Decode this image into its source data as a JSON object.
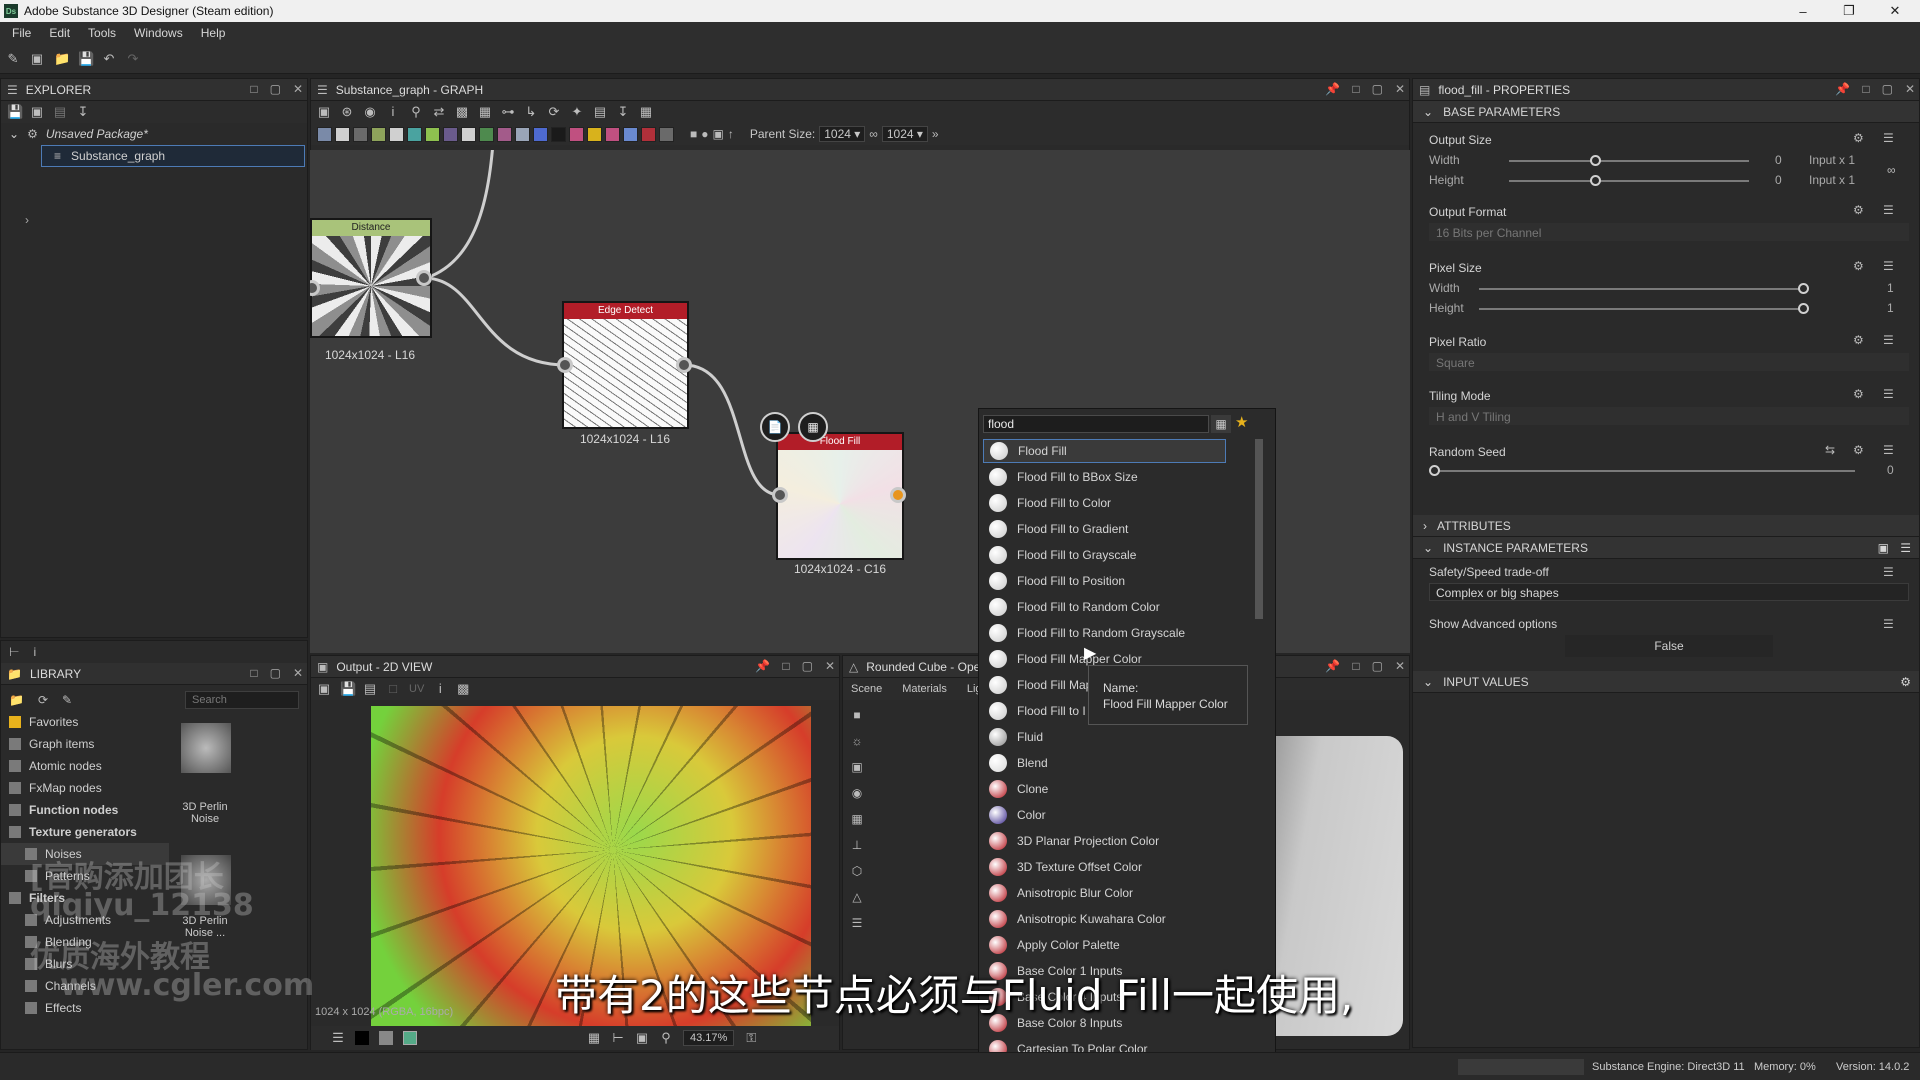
{
  "window": {
    "title": "Adobe Substance 3D Designer (Steam edition)",
    "logo": "Ds"
  },
  "menu": [
    "File",
    "Edit",
    "Tools",
    "Windows",
    "Help"
  ],
  "explorer": {
    "title": "EXPLORER",
    "package": "Unsaved Package*",
    "graph": "Substance_graph"
  },
  "graph": {
    "title": "Substance_graph - GRAPH",
    "parent_size_label": "Parent Size:",
    "parent_size_w": "1024",
    "parent_size_h": "1024",
    "nodes": {
      "distance": {
        "title": "Distance",
        "caption": "1024x1024 - L16"
      },
      "edge": {
        "title": "Edge Detect",
        "caption": "1024x1024 - L16"
      },
      "flood": {
        "title": "Flood Fill",
        "caption": "1024x1024 - C16"
      }
    }
  },
  "search_popup": {
    "query": "flood",
    "items": [
      "Flood Fill",
      "Flood Fill to BBox Size",
      "Flood Fill to Color",
      "Flood Fill to Gradient",
      "Flood Fill to Grayscale",
      "Flood Fill to Position",
      "Flood Fill to Random Color",
      "Flood Fill to Random Grayscale",
      "Flood Fill Mapper Color",
      "Flood Fill Map",
      "Flood Fill to I",
      "Fluid",
      "Blend",
      "Clone",
      "Color",
      "3D Planar Projection Color",
      "3D Texture Offset Color",
      "Anisotropic Blur Color",
      "Anisotropic Kuwahara Color",
      "Apply Color Palette",
      "Base Color 1 Inputs",
      "Base Color 4 Inputs",
      "Base Color 8 Inputs",
      "Cartesian To Polar Color",
      "Clamp Color"
    ],
    "item_colors": [
      "#c9c9c9",
      "#c9c9c9",
      "#c9c9c9",
      "#c9c9c9",
      "#c9c9c9",
      "#c9c9c9",
      "#c9c9c9",
      "#c9c9c9",
      "#c9c9c9",
      "#c9c9c9",
      "#c9c9c9",
      "#8a8a8a",
      "#d8d8d8",
      "#b3121b",
      "#3a2a8c",
      "#b3121b",
      "#b3121b",
      "#b3121b",
      "#b3121b",
      "#b3121b",
      "#b3121b",
      "#b3121b",
      "#b3121b",
      "#b3121b",
      "#b3121b"
    ],
    "tooltip_label": "Name:",
    "tooltip_value": "Flood Fill Mapper Color"
  },
  "properties": {
    "title": "flood_fill - PROPERTIES",
    "base_parameters": "BASE PARAMETERS",
    "output_size": {
      "label": "Output Size",
      "width_label": "Width",
      "height_label": "Height",
      "width_value": "0",
      "height_value": "0",
      "width_suffix": "Input x 1",
      "height_suffix": "Input x 1"
    },
    "output_format": {
      "label": "Output Format",
      "value": "16 Bits per Channel"
    },
    "pixel_size": {
      "label": "Pixel Size",
      "width_label": "Width",
      "height_label": "Height",
      "width_value": "1",
      "height_value": "1"
    },
    "pixel_ratio": {
      "label": "Pixel Ratio",
      "value": "Square"
    },
    "tiling_mode": {
      "label": "Tiling Mode",
      "value": "H and V Tiling"
    },
    "random_seed": {
      "label": "Random Seed",
      "value": "0"
    },
    "attributes": "ATTRIBUTES",
    "instance_parameters": "INSTANCE PARAMETERS",
    "safety": {
      "label": "Safety/Speed trade-off",
      "value": "Complex or big shapes"
    },
    "advanced": {
      "label": "Show Advanced options",
      "value": "False"
    },
    "input_values": "INPUT VALUES"
  },
  "library": {
    "title": "LIBRARY",
    "search_placeholder": "Search",
    "categories": [
      "Favorites",
      "Graph items",
      "Atomic nodes",
      "FxMap nodes",
      "Function nodes",
      "Texture generators",
      "Noises",
      "Patterns",
      "Filters",
      "Adjustments",
      "Blending",
      "Blurs",
      "Channels",
      "Effects"
    ],
    "thumbs": [
      "3D Perlin Noise",
      "3D Perlin Noise ..."
    ]
  },
  "view2d": {
    "title": "Output - 2D VIEW",
    "info": "1024 x 1024 (RGBA, 16bpc)",
    "zoom": "43.17%",
    "colorspace": "sRGB (default)",
    "uv_label": "UV"
  },
  "view3d": {
    "title": "Rounded Cube - OpenGL",
    "tabs": [
      "Scene",
      "Materials",
      "Lights"
    ]
  },
  "statusbar": {
    "engine": "Substance Engine: Direct3D 11",
    "memory": "Memory: 0%",
    "version": "Version: 14.0.2"
  },
  "overlay": {
    "subtitle": "带有2的这些节点必须与Fluid Fill一起使用,",
    "wm1": "[官购添加团长",
    "wm2": "qiqiyu_12138",
    "wm3": "优质海外教程",
    "wm4": "www.cgler.com"
  }
}
